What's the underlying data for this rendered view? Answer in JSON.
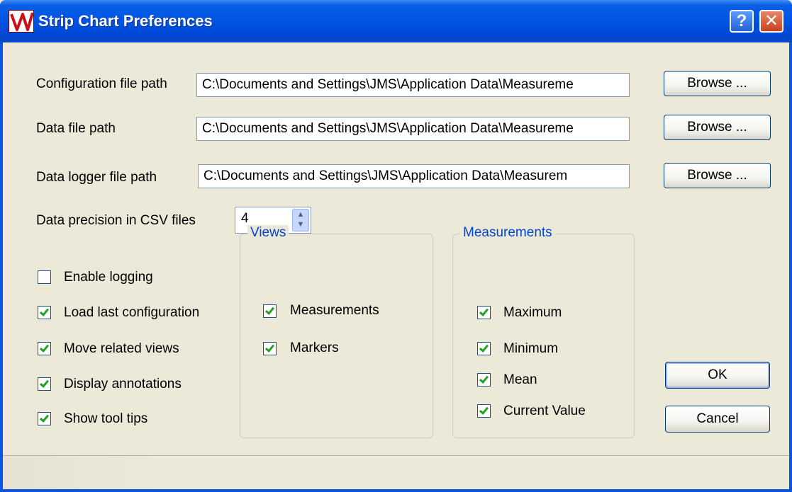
{
  "window": {
    "title": "Strip Chart Preferences",
    "help_glyph": "?",
    "close_glyph": "✕",
    "app_icon": "strip-chart-logo-icon",
    "colors": {
      "titlebar": "#0055e5",
      "face": "#ece9d8",
      "group_title": "#0046d5",
      "checkmark": "#21a121"
    }
  },
  "paths": [
    {
      "label": "Configuration file path",
      "value": "C:\\Documents and Settings\\JMS\\Application Data\\Measureme",
      "button": "Browse ..."
    },
    {
      "label": "Data file path",
      "value": "C:\\Documents and Settings\\JMS\\Application Data\\Measureme",
      "button": "Browse ..."
    },
    {
      "label": "Data logger file path",
      "value": "C:\\Documents and Settings\\JMS\\Application Data\\Measurem",
      "button": "Browse ..."
    }
  ],
  "precision": {
    "label": "Data precision in CSV files",
    "value": "4"
  },
  "options": [
    {
      "label": "Enable logging",
      "checked": false
    },
    {
      "label": "Load last configuration",
      "checked": true
    },
    {
      "label": "Move related views",
      "checked": true
    },
    {
      "label": "Display annotations",
      "checked": true
    },
    {
      "label": "Show tool tips",
      "checked": true
    }
  ],
  "views": {
    "title": "Views",
    "items": [
      {
        "label": "Measurements",
        "checked": true
      },
      {
        "label": "Markers",
        "checked": true
      }
    ]
  },
  "measurements": {
    "title": "Measurements",
    "items": [
      {
        "label": "Maximum",
        "checked": true
      },
      {
        "label": "Minimum",
        "checked": true
      },
      {
        "label": "Mean",
        "checked": true
      },
      {
        "label": "Current Value",
        "checked": true
      }
    ]
  },
  "buttons": {
    "ok": "OK",
    "cancel": "Cancel"
  }
}
